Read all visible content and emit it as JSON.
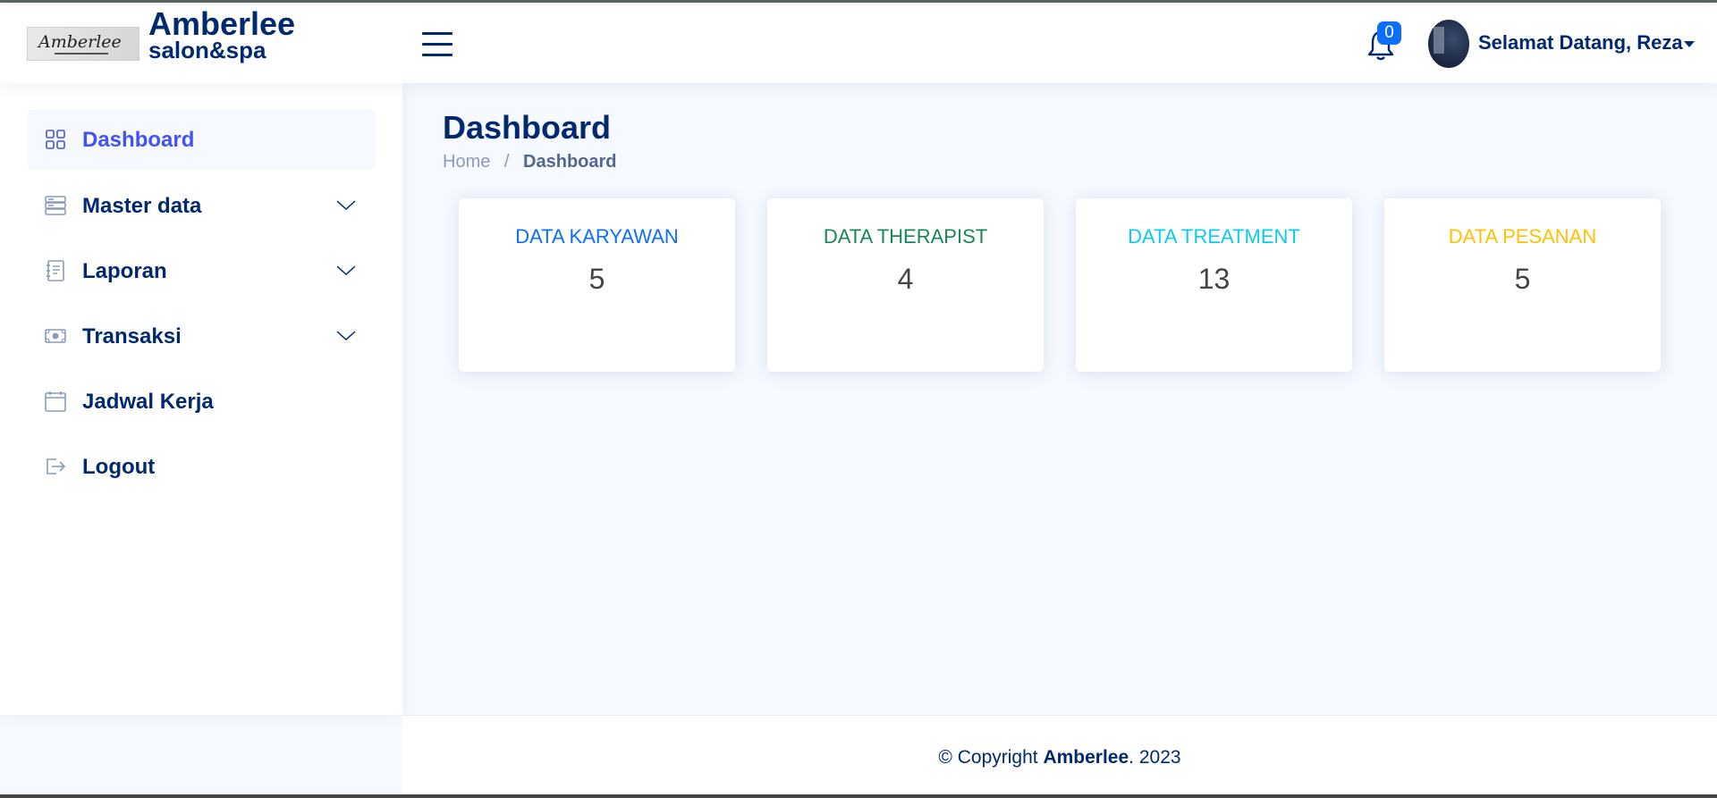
{
  "header": {
    "logo_text": "Amberlee",
    "brand_title": "Amberlee",
    "brand_sub": "salon&spa",
    "notification_count": "0",
    "user_greeting": "Selamat Datang, Reza"
  },
  "sidebar": {
    "items": [
      {
        "label": "Dashboard",
        "icon": "grid-icon",
        "active": true
      },
      {
        "label": "Master data",
        "icon": "server-icon",
        "expandable": true
      },
      {
        "label": "Laporan",
        "icon": "journal-text-icon",
        "expandable": true
      },
      {
        "label": "Transaksi",
        "icon": "cash-icon",
        "expandable": true
      },
      {
        "label": "Jadwal Kerja",
        "icon": "calendar-icon"
      },
      {
        "label": "Logout",
        "icon": "logout-icon"
      }
    ]
  },
  "main": {
    "page_title": "Dashboard",
    "breadcrumb": {
      "home": "Home",
      "separator": "/",
      "current": "Dashboard"
    },
    "cards": [
      {
        "title": "DATA KARYAWAN",
        "value": "5",
        "color": "#0d6efd"
      },
      {
        "title": "DATA THERAPIST",
        "value": "4",
        "color": "#198754"
      },
      {
        "title": "DATA TREATMENT",
        "value": "13",
        "color": "#0dcaf0"
      },
      {
        "title": "DATA PESANAN",
        "value": "5",
        "color": "#ffc107"
      }
    ]
  },
  "footer": {
    "prefix": "© Copyright",
    "brand": "Amberlee",
    "suffix": ". 2023"
  },
  "colors": {
    "primary": "#012970",
    "accent": "#4154f1",
    "background": "#f6f9ff"
  }
}
